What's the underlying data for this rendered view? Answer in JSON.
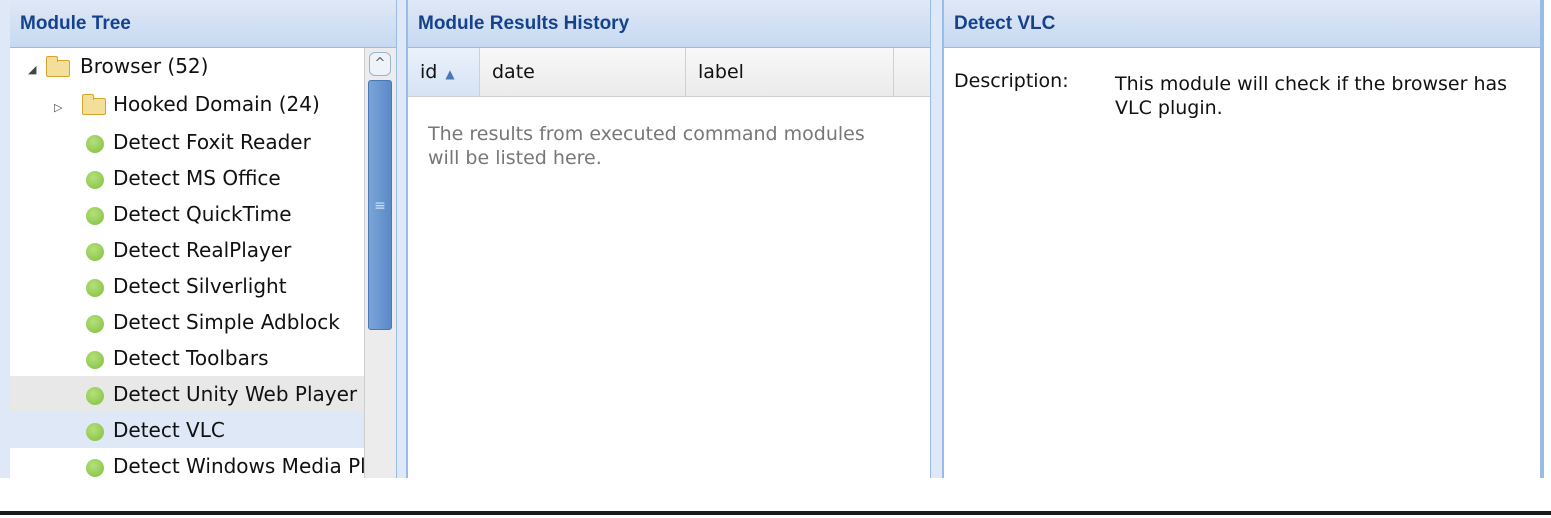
{
  "module_tree": {
    "title": "Module Tree",
    "nodes": [
      {
        "label": "Browser (52)",
        "type": "folder-open",
        "toggle": "◢"
      },
      {
        "label": "Hooked Domain (24)",
        "type": "folder",
        "toggle": "▷"
      },
      {
        "label": "Detect Foxit Reader",
        "type": "module"
      },
      {
        "label": "Detect MS Office",
        "type": "module"
      },
      {
        "label": "Detect QuickTime",
        "type": "module"
      },
      {
        "label": "Detect RealPlayer",
        "type": "module"
      },
      {
        "label": "Detect Silverlight",
        "type": "module"
      },
      {
        "label": "Detect Simple Adblock",
        "type": "module"
      },
      {
        "label": "Detect Toolbars",
        "type": "module"
      },
      {
        "label": "Detect Unity Web Player",
        "type": "module",
        "state": "hover"
      },
      {
        "label": "Detect VLC",
        "type": "module",
        "state": "selected"
      },
      {
        "label": "Detect Windows Media Pl",
        "type": "module"
      }
    ],
    "scroll_up": "^",
    "thumb_grip": "≡"
  },
  "results_history": {
    "title": "Module Results History",
    "columns": [
      {
        "label": "id",
        "sort": "ascending",
        "sort_icon": "▲"
      },
      {
        "label": "date"
      },
      {
        "label": "label"
      }
    ],
    "empty_text": "The results from executed command modules will be listed here."
  },
  "details": {
    "title": "Detect VLC",
    "description_label": "Description:",
    "description_text": "This module will check if the browser has VLC plugin."
  },
  "colors": {
    "header_text": "#15428b",
    "header_bg": "#c7d9f1",
    "border": "#99bbe8",
    "status_dot": "#8fcf4f"
  }
}
